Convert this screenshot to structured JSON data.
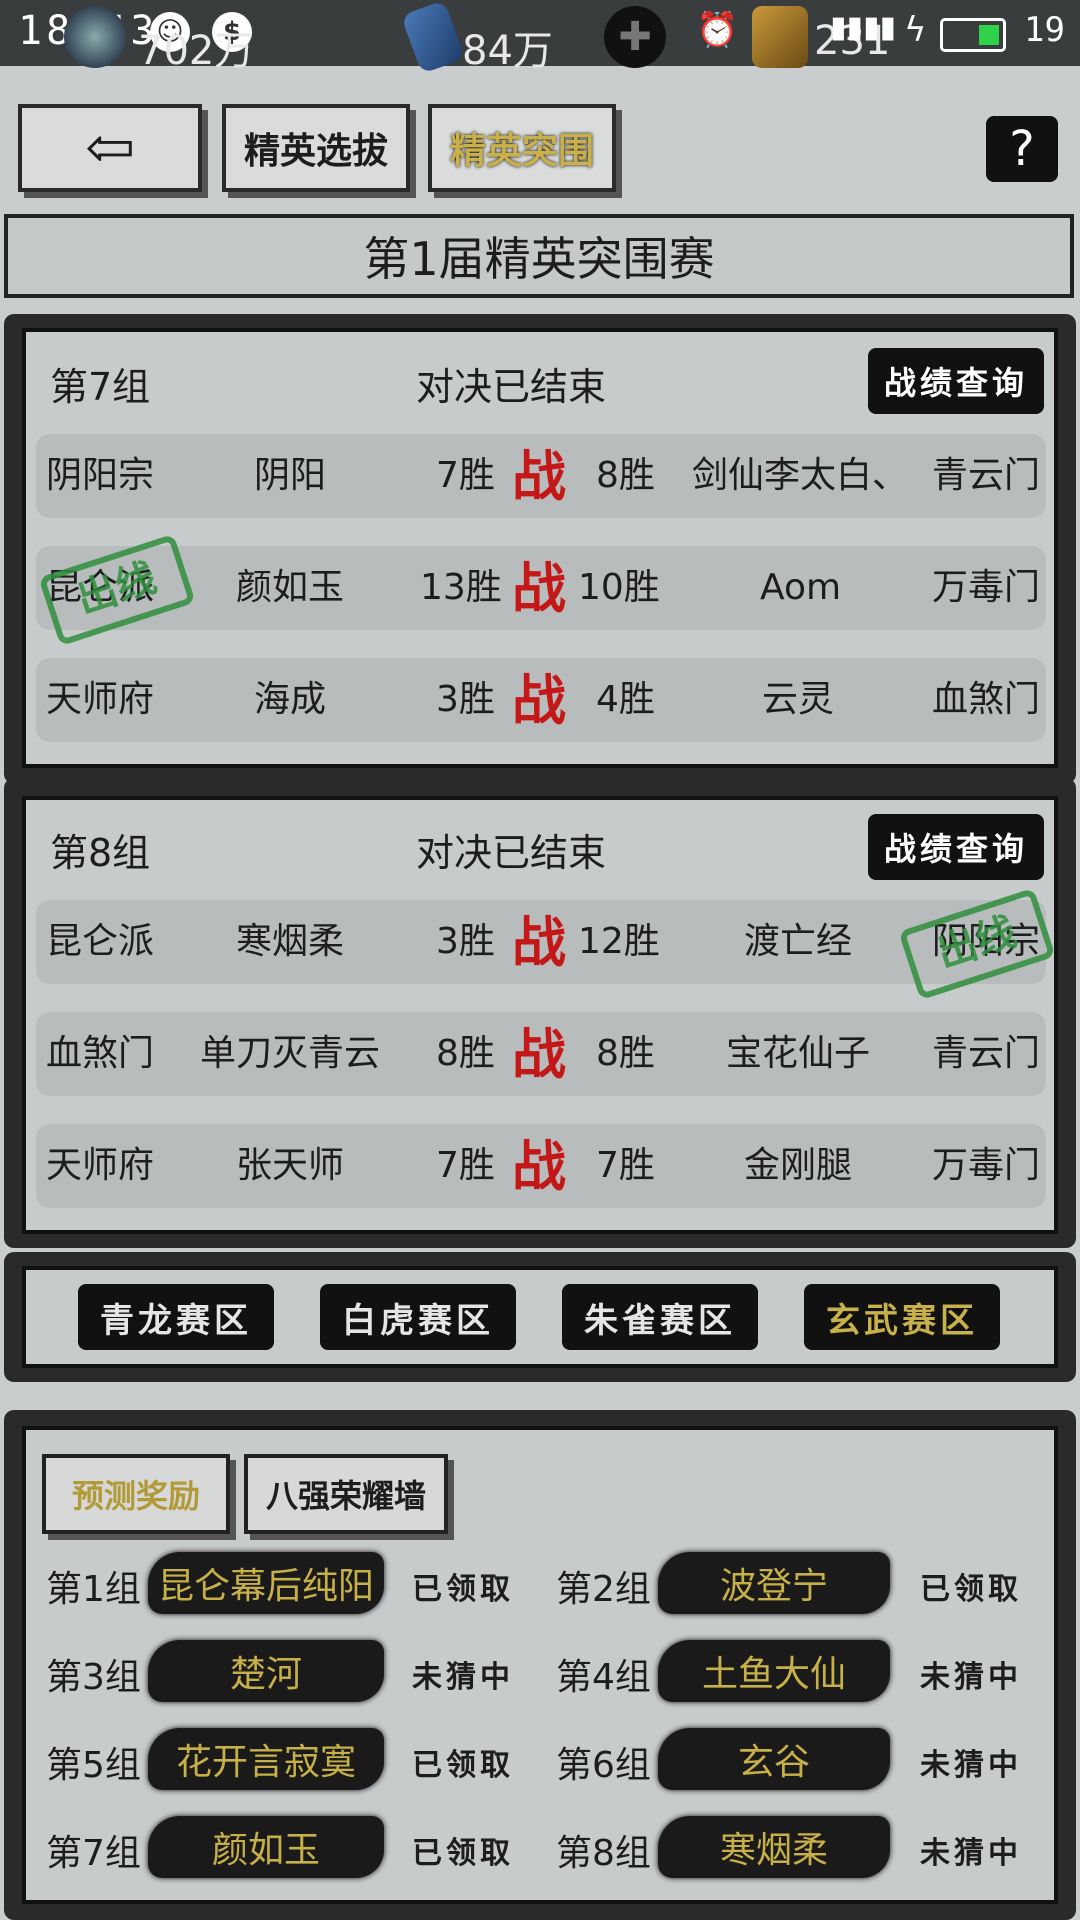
{
  "status_bar": {
    "time": "18:43",
    "signal": "4",
    "battery_level": "19"
  },
  "resources": {
    "coins": "702万",
    "gems": "84万",
    "tokens": "231"
  },
  "nav": {
    "elite_select": "精英选拔",
    "elite_breakout": "精英突围",
    "help": "?"
  },
  "page_title": "第1届精英突围赛",
  "groups": [
    {
      "label": "第7组",
      "status": "对决已结束",
      "query_label": "战绩查询",
      "matches": [
        {
          "left_sect": "阴阳宗",
          "left_player": "阴阳",
          "left_wins": "7胜",
          "vs": "战",
          "right_wins": "8胜",
          "right_player": "剑仙李太白、",
          "right_sect": "青云门",
          "stamp": ""
        },
        {
          "left_sect": "昆仑派",
          "left_player": "颜如玉",
          "left_wins": "13胜",
          "vs": "战",
          "right_wins": "10胜",
          "right_player": "Aom",
          "right_sect": "万毒门",
          "stamp": "出线"
        },
        {
          "left_sect": "天师府",
          "left_player": "海成",
          "left_wins": "3胜",
          "vs": "战",
          "right_wins": "4胜",
          "right_player": "云灵",
          "right_sect": "血煞门",
          "stamp": ""
        }
      ]
    },
    {
      "label": "第8组",
      "status": "对决已结束",
      "query_label": "战绩查询",
      "matches": [
        {
          "left_sect": "昆仑派",
          "left_player": "寒烟柔",
          "left_wins": "3胜",
          "vs": "战",
          "right_wins": "12胜",
          "right_player": "渡亡经",
          "right_sect": "阴阳宗",
          "stamp": "出线"
        },
        {
          "left_sect": "血煞门",
          "left_player": "单刀灭青云",
          "left_wins": "8胜",
          "vs": "战",
          "right_wins": "8胜",
          "right_player": "宝花仙子",
          "right_sect": "青云门",
          "stamp": ""
        },
        {
          "left_sect": "天师府",
          "left_player": "张天师",
          "left_wins": "7胜",
          "vs": "战",
          "right_wins": "7胜",
          "right_player": "金刚腿",
          "right_sect": "万毒门",
          "stamp": ""
        }
      ]
    }
  ],
  "zones": [
    "青龙赛区",
    "白虎赛区",
    "朱雀赛区",
    "玄武赛区"
  ],
  "active_zone": "玄武赛区",
  "tabs": {
    "predict_reward": "预测奖励",
    "top8_wall": "八强荣耀墙"
  },
  "predictions": [
    {
      "group": "第1组",
      "name": "昆仑幕后纯阳",
      "status": "已领取"
    },
    {
      "group": "第2组",
      "name": "波登宁",
      "status": "已领取"
    },
    {
      "group": "第3组",
      "name": "楚河",
      "status": "未猜中"
    },
    {
      "group": "第4组",
      "name": "土鱼大仙",
      "status": "未猜中"
    },
    {
      "group": "第5组",
      "name": "花开言寂寞",
      "status": "已领取"
    },
    {
      "group": "第6组",
      "name": "玄谷",
      "status": "未猜中"
    },
    {
      "group": "第7组",
      "name": "颜如玉",
      "status": "已领取"
    },
    {
      "group": "第8组",
      "name": "寒烟柔",
      "status": "未猜中"
    }
  ],
  "colors": {
    "vs_red": "#c41818",
    "gold": "#c8b048",
    "stamp_green": "#2f8f3e",
    "panel_dark": "#2a2a2a"
  }
}
